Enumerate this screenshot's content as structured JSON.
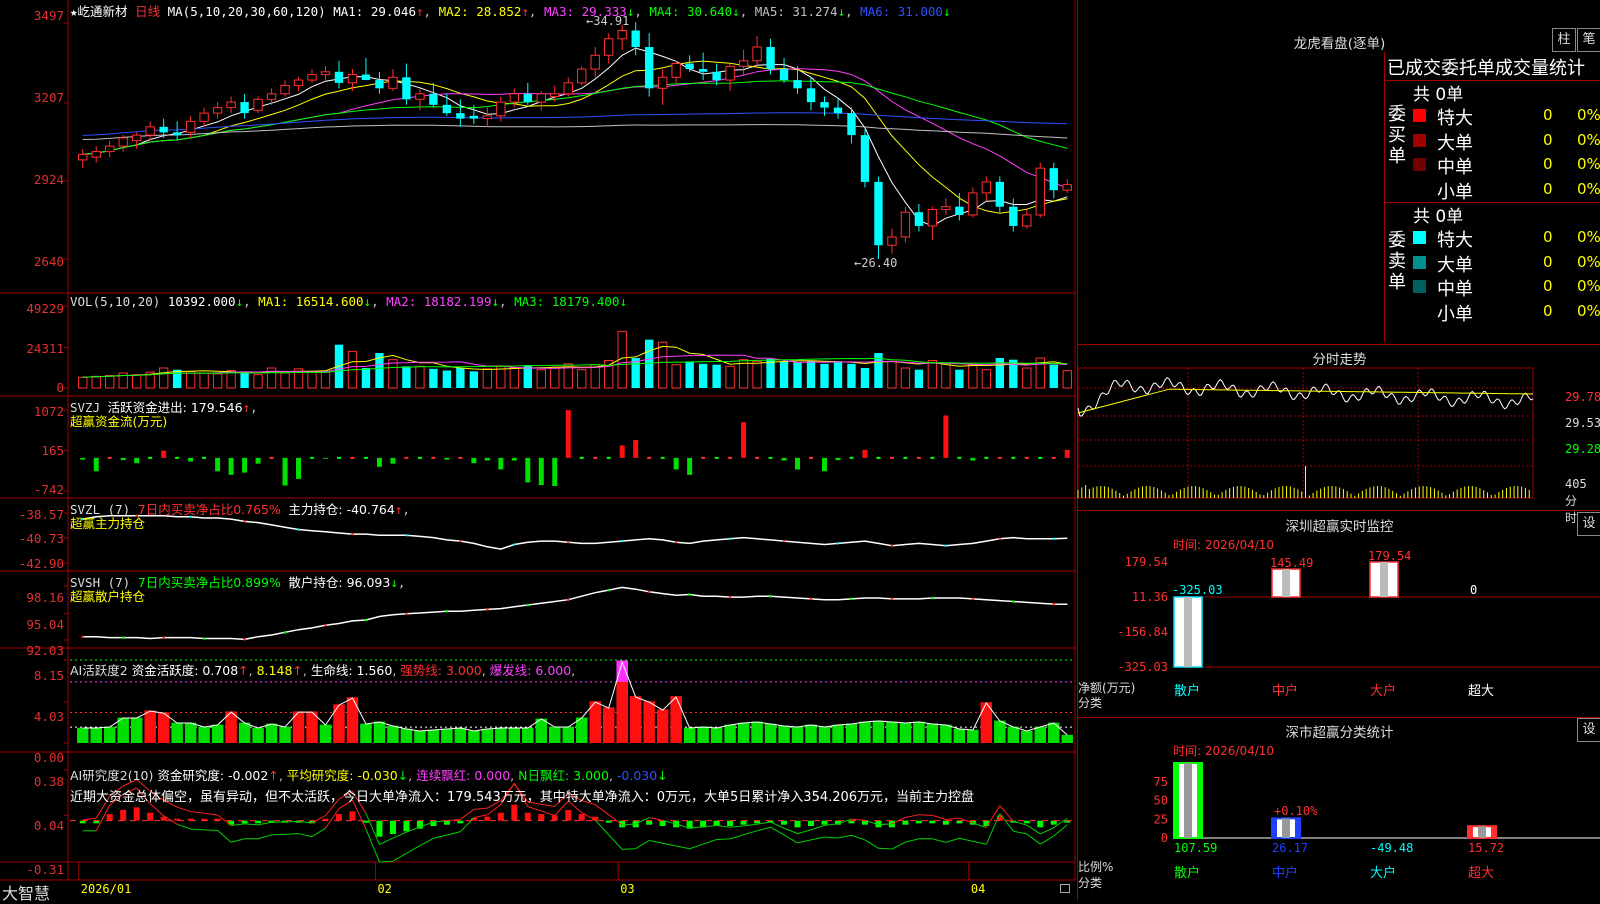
{
  "stock": {
    "star": "★",
    "name": "屹通新材",
    "period": "日线"
  },
  "main": {
    "ma_label": "MA(5,10,20,30,60,120)",
    "mas": [
      {
        "text": "MA1: 29.046",
        "arrow": "↑",
        "color": "#ffffff",
        "arrow_color": "#ff3030"
      },
      {
        "text": "MA2: 28.852",
        "arrow": "↑",
        "color": "#ffff00",
        "arrow_color": "#ff3030"
      },
      {
        "text": "MA3: 29.333",
        "arrow": "↓",
        "color": "#ff40ff",
        "arrow_color": "#00ff00"
      },
      {
        "text": "MA4: 30.640",
        "arrow": "↓",
        "color": "#00ff00",
        "arrow_color": "#00ff00"
      },
      {
        "text": "MA5: 31.274",
        "arrow": "↓",
        "color": "#c0c0c0",
        "arrow_color": "#00ff00"
      },
      {
        "text": "MA6: 31.000",
        "arrow": "↓",
        "color": "#3050ff",
        "arrow_color": "#00ff00"
      }
    ],
    "y_labels": [
      "3497",
      "3207",
      "2924",
      "2640"
    ],
    "y_values": [
      34.97,
      32.07,
      29.24,
      26.4
    ],
    "high_label": "34.91",
    "low_label": "26.40"
  },
  "vol": {
    "label": "VOL(5,10,20)",
    "value": "10392.000",
    "ma1": "MA1: 16514.600",
    "ma2": "MA2: 18182.199",
    "ma3": "MA3: 18179.400",
    "arrow": "↓",
    "y_labels": [
      "49229",
      "24311",
      "0"
    ]
  },
  "svzj": {
    "label": "SVZJ",
    "text": "活跃资金进出: 179.546",
    "arrow": "↑",
    "subtitle": "超赢资金流(万元)",
    "y_labels": [
      "1072",
      "165",
      "-742"
    ]
  },
  "svzl": {
    "label": "SVZL (7)",
    "text1": "7日内买卖净占比0.765%",
    "text2": "主力持仓: -40.764",
    "arrow": "↑",
    "subtitle": "超赢主力持仓",
    "y_labels": [
      "-38.57",
      "-40.73",
      "-42.90"
    ]
  },
  "svsh": {
    "label": "SVSH (7)",
    "text1": "7日内买卖净占比0.899%",
    "text2": "散户持仓: 96.093",
    "arrow": "↓",
    "subtitle": "超赢散户持仓",
    "y_labels": [
      "98.16",
      "95.04",
      "92.03"
    ]
  },
  "ai_act": {
    "label": "AI活跃度2",
    "text1": "资金活跃度: 0.708",
    "text2": "8.148",
    "text3": "生命线: 1.560",
    "text4": "强势线: 3.000",
    "text5": "爆发线: 6.000",
    "y_labels": [
      "8.15",
      "4.03",
      "0.00"
    ]
  },
  "ai_res": {
    "label": "AI研究度2(10)",
    "text1": "资金研究度: -0.002",
    "text2": "平均研究度: -0.030",
    "text3": "连续飘红: 0.000",
    "text4": "N日飘红: 3.000",
    "text5": "-0.030",
    "comment": "近期大资金总体偏空，虽有异动，但不太活跃，今日大单净流入：179.543万元，其中特大单净流入：0万元，大单5日累计净入354.206万元，当前主力控盘",
    "y_labels": [
      "0.38",
      "0.04",
      "-0.31"
    ]
  },
  "xaxis": {
    "labels": [
      "2026/01",
      "02",
      "03",
      "04"
    ]
  },
  "brand": "大智慧",
  "right": {
    "lhb_title": "龙虎看盘(逐单)",
    "btn_bar": "柱",
    "btn_tick": "笔",
    "tabs_title": "已成交委托单成交量统计",
    "buy": {
      "side": [
        "委",
        "买",
        "单"
      ],
      "total": "共 0单",
      "rows": [
        {
          "label": "特大",
          "value": "0",
          "pct": "0%",
          "color": "#ff0000"
        },
        {
          "label": "大单",
          "value": "0",
          "pct": "0%",
          "color": "#a00000"
        },
        {
          "label": "中单",
          "value": "0",
          "pct": "0%",
          "color": "#700000"
        },
        {
          "label": "小单",
          "value": "0",
          "pct": "0%",
          "color": "#000000"
        }
      ]
    },
    "sell": {
      "side": [
        "委",
        "卖",
        "单"
      ],
      "total": "共 0单",
      "rows": [
        {
          "label": "特大",
          "value": "0",
          "pct": "0%",
          "color": "#00ffff"
        },
        {
          "label": "大单",
          "value": "0",
          "pct": "0%",
          "color": "#009090"
        },
        {
          "label": "中单",
          "value": "0",
          "pct": "0%",
          "color": "#006060"
        },
        {
          "label": "小单",
          "value": "0",
          "pct": "0%",
          "color": "#000000"
        }
      ]
    },
    "intraday": {
      "title": "分时走势",
      "y_labels": [
        "29.78",
        "29.53",
        "29.28"
      ],
      "vol_label": "405",
      "unit": "分时"
    },
    "sz_monitor": {
      "title": "深圳超赢实时监控",
      "set": "设",
      "time": "时间: 2026/04/10",
      "y_labels": [
        "179.54",
        "11.36",
        "-156.84",
        "-325.03"
      ],
      "bars": [
        {
          "cat": "散户",
          "value": -325.03,
          "label": "-325.03",
          "color": "#00e0ff"
        },
        {
          "cat": "中户",
          "value": 145.49,
          "label": "145.49",
          "color": "#ff3030"
        },
        {
          "cat": "大户",
          "value": 179.54,
          "label": "179.54",
          "color": "#ff3030"
        },
        {
          "cat": "超大",
          "value": 0,
          "label": "0",
          "color": "#ffffff"
        }
      ],
      "axis_title": "净额(万元)",
      "cat_title": "分类",
      "cat_colors": [
        "#00ffff",
        "#ff3030",
        "#ff3030",
        "#ffffff"
      ]
    },
    "sz_class": {
      "title": "深市超赢分类统计",
      "set": "设",
      "time": "时间: 2026/04/10",
      "y_labels": [
        "75",
        "50",
        "25",
        "0"
      ],
      "bars": [
        {
          "cat": "散户",
          "value": 107.59,
          "label": "107.59",
          "color": "#00ff00"
        },
        {
          "cat": "中户",
          "value": 26.17,
          "label": "26.17",
          "color": "#2040ff"
        },
        {
          "cat": "大户",
          "value": -49.48,
          "label": "-49.48",
          "color": "#00ffff"
        },
        {
          "cat": "超大",
          "value": 15.72,
          "label": "15.72",
          "color": "#ff3030"
        }
      ],
      "top_note": "+0.10%",
      "axis_title": "比例%",
      "cat_title": "分类",
      "cat_colors": [
        "#00ff00",
        "#2040ff",
        "#00ffff",
        "#ff3030"
      ]
    }
  },
  "chart_data": {
    "type": "candlestick",
    "ylim": [
      26.0,
      35.3
    ],
    "candles": [
      [
        30.0,
        30.4,
        29.7,
        30.2
      ],
      [
        30.1,
        30.5,
        29.9,
        30.3
      ],
      [
        30.3,
        30.7,
        30.1,
        30.5
      ],
      [
        30.5,
        30.9,
        30.3,
        30.8
      ],
      [
        30.7,
        31.0,
        30.4,
        30.9
      ],
      [
        30.9,
        31.4,
        30.7,
        31.2
      ],
      [
        31.2,
        31.5,
        30.8,
        31.0
      ],
      [
        31.0,
        31.4,
        30.7,
        30.9
      ],
      [
        31.0,
        31.6,
        30.8,
        31.4
      ],
      [
        31.4,
        31.9,
        31.2,
        31.7
      ],
      [
        31.7,
        32.1,
        31.5,
        31.9
      ],
      [
        31.9,
        32.3,
        31.7,
        32.1
      ],
      [
        32.1,
        32.4,
        31.5,
        31.7
      ],
      [
        31.8,
        32.3,
        31.7,
        32.2
      ],
      [
        32.2,
        32.6,
        32.0,
        32.4
      ],
      [
        32.4,
        32.9,
        32.3,
        32.7
      ],
      [
        32.7,
        33.0,
        32.5,
        32.9
      ],
      [
        32.9,
        33.3,
        32.8,
        33.1
      ],
      [
        33.1,
        33.4,
        32.9,
        33.2
      ],
      [
        33.2,
        33.6,
        32.6,
        32.8
      ],
      [
        32.8,
        33.3,
        32.5,
        33.1
      ],
      [
        33.1,
        33.7,
        32.9,
        32.9
      ],
      [
        32.9,
        33.2,
        32.4,
        32.6
      ],
      [
        32.6,
        33.3,
        32.5,
        33.0
      ],
      [
        33.0,
        33.5,
        32.0,
        32.2
      ],
      [
        32.2,
        32.6,
        31.8,
        32.4
      ],
      [
        32.4,
        32.8,
        31.9,
        32.0
      ],
      [
        32.0,
        32.4,
        31.6,
        31.7
      ],
      [
        31.7,
        32.2,
        31.2,
        31.5
      ],
      [
        31.6,
        32.0,
        31.3,
        31.5
      ],
      [
        31.5,
        31.9,
        31.2,
        31.6
      ],
      [
        31.6,
        32.3,
        31.4,
        32.1
      ],
      [
        32.1,
        32.6,
        31.9,
        32.4
      ],
      [
        32.4,
        32.8,
        32.0,
        32.1
      ],
      [
        32.1,
        32.5,
        31.8,
        32.4
      ],
      [
        32.3,
        32.7,
        32.1,
        32.4
      ],
      [
        32.4,
        33.0,
        32.3,
        32.8
      ],
      [
        32.8,
        33.4,
        32.7,
        33.3
      ],
      [
        33.3,
        34.1,
        33.0,
        33.8
      ],
      [
        33.8,
        34.6,
        33.5,
        34.4
      ],
      [
        34.4,
        34.91,
        34.0,
        34.7
      ],
      [
        34.7,
        35.0,
        33.8,
        34.1
      ],
      [
        34.1,
        34.6,
        32.3,
        32.6
      ],
      [
        32.6,
        33.3,
        32.0,
        33.0
      ],
      [
        33.0,
        33.6,
        32.8,
        33.5
      ],
      [
        33.5,
        33.8,
        33.2,
        33.3
      ],
      [
        33.3,
        33.9,
        32.9,
        33.2
      ],
      [
        33.2,
        33.5,
        32.7,
        32.9
      ],
      [
        32.9,
        33.5,
        32.5,
        33.4
      ],
      [
        33.4,
        34.0,
        33.1,
        33.6
      ],
      [
        33.6,
        34.5,
        33.4,
        34.1
      ],
      [
        34.1,
        34.4,
        33.1,
        33.3
      ],
      [
        33.3,
        33.7,
        32.8,
        32.9
      ],
      [
        32.9,
        33.4,
        32.4,
        32.6
      ],
      [
        32.6,
        33.0,
        31.8,
        32.1
      ],
      [
        32.1,
        32.3,
        31.6,
        31.9
      ],
      [
        31.9,
        32.2,
        31.5,
        31.7
      ],
      [
        31.7,
        31.9,
        30.6,
        30.9
      ],
      [
        30.9,
        31.1,
        29.0,
        29.2
      ],
      [
        29.2,
        29.4,
        26.4,
        26.9
      ],
      [
        26.9,
        27.5,
        26.6,
        27.2
      ],
      [
        27.2,
        28.3,
        27.0,
        28.1
      ],
      [
        28.1,
        28.4,
        27.4,
        27.6
      ],
      [
        27.6,
        28.3,
        27.1,
        28.2
      ],
      [
        28.2,
        28.6,
        28.0,
        28.3
      ],
      [
        28.3,
        28.8,
        27.8,
        28.0
      ],
      [
        28.0,
        29.0,
        27.9,
        28.8
      ],
      [
        28.8,
        29.4,
        28.5,
        29.2
      ],
      [
        29.2,
        29.4,
        28.1,
        28.3
      ],
      [
        28.3,
        28.6,
        27.4,
        27.6
      ],
      [
        27.6,
        28.2,
        27.5,
        28.0
      ],
      [
        28.0,
        29.9,
        27.9,
        29.7
      ],
      [
        29.7,
        29.9,
        28.6,
        28.9
      ],
      [
        28.9,
        29.3,
        28.8,
        29.1
      ]
    ],
    "volumes": [
      6500,
      7000,
      7500,
      9000,
      8000,
      9500,
      12000,
      11000,
      10000,
      9000,
      8500,
      10500,
      9500,
      8000,
      12000,
      9000,
      11500,
      10000,
      9500,
      26000,
      22000,
      12000,
      21000,
      17000,
      13000,
      13000,
      11500,
      10500,
      12000,
      10000,
      11500,
      13000,
      12000,
      13500,
      11000,
      12500,
      14500,
      11000,
      14000,
      16500,
      34000,
      18000,
      29000,
      27500,
      14000,
      16000,
      14500,
      14000,
      13000,
      17000,
      16000,
      17500,
      16000,
      15500,
      16500,
      14500,
      16000,
      14500,
      12000,
      21000,
      16000,
      12000,
      11000,
      16500,
      15000,
      11000,
      14000,
      11000,
      18000,
      17000,
      12000,
      18000,
      14000,
      10392
    ],
    "volume_up": [
      true,
      true,
      true,
      true,
      true,
      true,
      true,
      false,
      true,
      true,
      true,
      true,
      false,
      true,
      true,
      true,
      true,
      true,
      true,
      false,
      true,
      false,
      false,
      true,
      false,
      true,
      false,
      false,
      false,
      false,
      true,
      true,
      true,
      false,
      true,
      true,
      true,
      true,
      true,
      true,
      true,
      false,
      false,
      true,
      true,
      false,
      false,
      false,
      true,
      true,
      true,
      false,
      false,
      false,
      false,
      false,
      false,
      false,
      false,
      false,
      true,
      true,
      false,
      true,
      true,
      false,
      true,
      true,
      false,
      false,
      true,
      true,
      false,
      true
    ],
    "svzj": [
      -40,
      -300,
      0,
      -50,
      -120,
      0,
      160,
      0,
      -80,
      0,
      -300,
      -380,
      -330,
      -130,
      0,
      -620,
      -470,
      0,
      -20,
      0,
      0,
      0,
      -200,
      -130,
      0,
      0,
      0,
      -40,
      0,
      -120,
      -60,
      -260,
      -60,
      -550,
      -610,
      -630,
      1070,
      0,
      0,
      0,
      280,
      400,
      0,
      0,
      -260,
      -380,
      0,
      0,
      0,
      800,
      0,
      0,
      -60,
      -260,
      0,
      -300,
      -50,
      0,
      180,
      0,
      0,
      0,
      0,
      0,
      950,
      0,
      -60,
      0,
      0,
      0,
      0,
      0,
      0,
      180
    ],
    "svzl": [
      -39.1,
      -38.9,
      -38.8,
      -38.8,
      -38.8,
      -38.8,
      -38.8,
      -38.9,
      -38.9,
      -39.0,
      -39.0,
      -39.1,
      -39.3,
      -39.4,
      -39.6,
      -39.8,
      -40.0,
      -40.1,
      -40.2,
      -40.3,
      -40.4,
      -40.4,
      -40.5,
      -40.5,
      -40.5,
      -40.6,
      -40.7,
      -40.9,
      -41.0,
      -41.2,
      -41.5,
      -41.7,
      -41.3,
      -41.1,
      -41.0,
      -41.0,
      -41.1,
      -41.2,
      -41.2,
      -41.1,
      -41.0,
      -40.9,
      -40.8,
      -40.9,
      -41.1,
      -41.2,
      -41.0,
      -40.9,
      -40.8,
      -40.7,
      -40.8,
      -40.9,
      -41.0,
      -41.1,
      -41.2,
      -41.3,
      -41.2,
      -41.1,
      -41.0,
      -41.2,
      -41.4,
      -41.3,
      -41.2,
      -41.3,
      -41.4,
      -41.3,
      -41.2,
      -41.0,
      -40.8,
      -40.7,
      -40.8,
      -40.8,
      -40.8,
      -40.76
    ],
    "svsh": [
      92.4,
      92.4,
      92.3,
      92.3,
      92.3,
      92.2,
      92.3,
      92.3,
      92.3,
      92.2,
      92.2,
      92.2,
      92.1,
      92.4,
      92.6,
      92.9,
      93.2,
      93.4,
      93.7,
      93.9,
      94.2,
      94.3,
      94.7,
      94.9,
      95.0,
      95.1,
      95.2,
      95.3,
      95.3,
      95.4,
      95.5,
      95.6,
      95.8,
      96.0,
      96.2,
      96.4,
      96.6,
      97.0,
      97.4,
      97.7,
      98.0,
      97.8,
      97.5,
      97.3,
      97.1,
      97.2,
      97.0,
      97.0,
      96.9,
      96.9,
      97.0,
      97.0,
      96.9,
      96.8,
      96.7,
      96.6,
      96.6,
      96.7,
      96.8,
      96.8,
      96.7,
      96.7,
      96.7,
      96.8,
      96.8,
      96.8,
      96.7,
      96.6,
      96.5,
      96.4,
      96.3,
      96.2,
      96.1,
      96.09
    ],
    "ai_act": [
      1.5,
      1.5,
      1.6,
      2.5,
      2.5,
      3.2,
      3.0,
      2.0,
      2.0,
      1.6,
      1.8,
      3.1,
      2.0,
      1.5,
      1.9,
      1.6,
      3.1,
      3.1,
      1.8,
      3.8,
      4.5,
      1.9,
      2.1,
      1.7,
      1.4,
      1.2,
      1.3,
      1.4,
      1.5,
      1.2,
      1.4,
      1.5,
      1.5,
      1.5,
      2.4,
      1.6,
      1.6,
      2.5,
      4.1,
      3.5,
      8.1,
      4.6,
      4.1,
      3.3,
      4.6,
      1.5,
      1.6,
      1.5,
      1.8,
      2.0,
      2.1,
      1.9,
      1.7,
      1.6,
      1.8,
      1.6,
      1.8,
      1.9,
      2.1,
      2.2,
      2.1,
      2.0,
      2.1,
      1.9,
      1.8,
      1.4,
      1.3,
      4.0,
      2.2,
      1.6,
      1.2,
      1.6,
      2.0,
      0.8
    ],
    "ai_act_pink_index": 40,
    "ai_res": [
      -0.02,
      -0.02,
      0.05,
      0.08,
      0.1,
      0.06,
      0.03,
      0.01,
      0.0,
      0.0,
      0.0,
      -0.03,
      -0.02,
      -0.02,
      -0.01,
      -0.01,
      -0.01,
      -0.02,
      0.0,
      0.05,
      0.07,
      -0.01,
      -0.12,
      -0.1,
      -0.08,
      -0.06,
      -0.04,
      -0.03,
      -0.02,
      0.02,
      0.03,
      0.06,
      0.12,
      0.06,
      0.05,
      0.04,
      0.08,
      0.05,
      0.03,
      -0.01,
      -0.05,
      -0.05,
      -0.03,
      -0.04,
      -0.05,
      -0.06,
      -0.05,
      -0.04,
      -0.04,
      -0.03,
      -0.02,
      -0.01,
      -0.03,
      -0.05,
      -0.04,
      -0.03,
      -0.03,
      -0.02,
      -0.03,
      -0.05,
      -0.05,
      -0.03,
      -0.02,
      -0.02,
      -0.03,
      -0.02,
      -0.03,
      -0.04,
      0.04,
      -0.01,
      -0.02,
      -0.05,
      -0.03,
      -0.002
    ],
    "x_labels": [
      "2026/01",
      "02",
      "03",
      "04"
    ],
    "x_label_index": [
      0,
      22,
      40,
      66
    ]
  }
}
